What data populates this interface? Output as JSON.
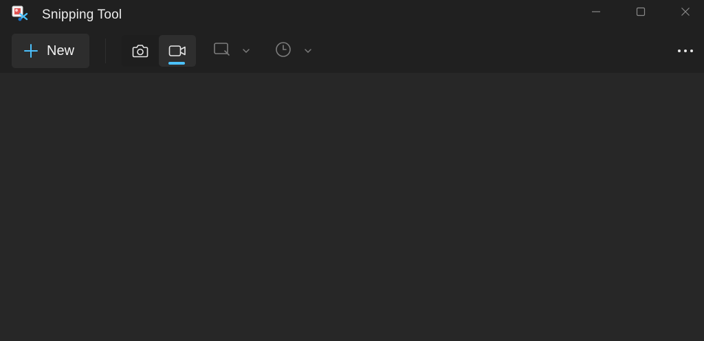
{
  "window": {
    "title": "Snipping Tool"
  },
  "toolbar": {
    "new_label": "New",
    "mode_selected": "video",
    "modes": [
      {
        "id": "screenshot",
        "icon": "camera-icon"
      },
      {
        "id": "video",
        "icon": "video-camera-icon"
      }
    ],
    "shape_icon": "rectangle-snip-icon",
    "timer_icon": "clock-icon"
  },
  "colors": {
    "accent": "#4cc2ff",
    "titlebar_bg": "#202020",
    "canvas_bg": "#272727"
  }
}
